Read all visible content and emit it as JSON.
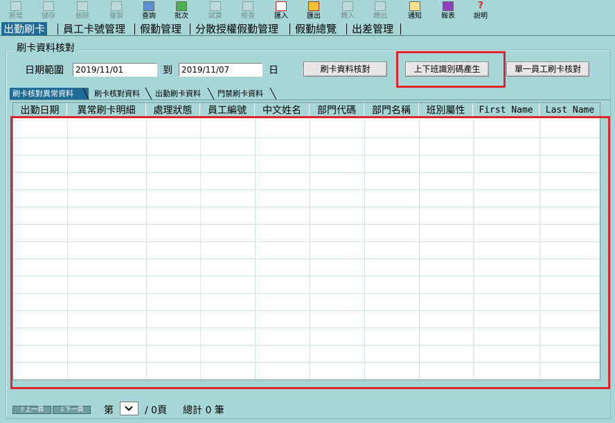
{
  "toolbar": [
    {
      "label": "新增",
      "icon": "new-icon",
      "enabled": false
    },
    {
      "label": "儲存",
      "icon": "save-icon",
      "enabled": false
    },
    {
      "label": "刪除",
      "icon": "delete-icon",
      "enabled": false
    },
    {
      "label": "複製",
      "icon": "copy-icon",
      "enabled": false
    },
    {
      "label": "查詢",
      "icon": "query-icon",
      "enabled": true
    },
    {
      "label": "批次",
      "icon": "batch-icon",
      "enabled": true
    },
    {
      "label": "試算",
      "icon": "calculator-icon",
      "enabled": false
    },
    {
      "label": "檢查",
      "icon": "check-icon",
      "enabled": false
    },
    {
      "label": "匯入",
      "icon": "import-icon",
      "enabled": true
    },
    {
      "label": "匯出",
      "icon": "export-icon",
      "enabled": true
    },
    {
      "label": "轉入",
      "icon": "transfer-in-icon",
      "enabled": false
    },
    {
      "label": "轉出",
      "icon": "transfer-out-icon",
      "enabled": false
    },
    {
      "label": "通知",
      "icon": "notify-icon",
      "enabled": true
    },
    {
      "label": "報表",
      "icon": "report-icon",
      "enabled": true
    },
    {
      "label": "說明",
      "icon": "help-icon",
      "enabled": true
    }
  ],
  "main_tabs": [
    "出勤刷卡",
    "員工卡號管理",
    "假勤管理",
    "分散授權假勤管理",
    "假勤總覽",
    "出差管理"
  ],
  "main_tab_active": 0,
  "group": {
    "title": "刷卡資料核對",
    "date_label": "日期範圍",
    "date_from": "2019/11/01",
    "to_label": "到",
    "date_to": "2019/11/07",
    "day_label": "日",
    "btn_verify": "刷卡資料核對",
    "btn_generate": "上下班識別碼產生",
    "btn_single": "單一員工刷卡核對"
  },
  "sub_tabs": [
    "刷卡核對異常資料",
    "刷卡核對資料",
    "出勤刷卡資料",
    "門禁刷卡資料"
  ],
  "sub_tab_active": 0,
  "grid": {
    "columns": [
      "出勤日期",
      "異常刷卡明細",
      "處理狀態",
      "員工編號",
      "中文姓名",
      "部門代碼",
      "部門名稱",
      "班別屬性",
      "First Name",
      "Last Name"
    ]
  },
  "footer": {
    "prev": "上一頁",
    "next": "下一頁",
    "page_prefix": "第",
    "page_suffix": "/ 0頁",
    "total": "總計 0 筆"
  },
  "colors": {
    "background": "#a6d6d6",
    "active_tab": "#1e6c96",
    "highlight": "#e3232b"
  }
}
